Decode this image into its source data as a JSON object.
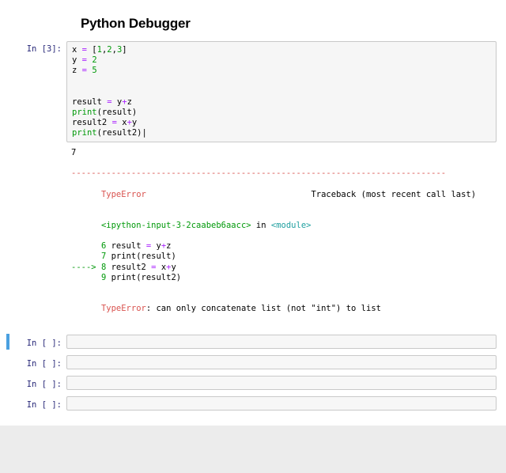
{
  "title": "Python Debugger",
  "cell": {
    "prompt": "In [3]:",
    "lines": [
      {
        "segments": [
          {
            "t": "x ",
            "c": "tok-var"
          },
          {
            "t": "=",
            "c": "tok-op"
          },
          {
            "t": " [",
            "c": "tok-var"
          },
          {
            "t": "1",
            "c": "tok-num"
          },
          {
            "t": ",",
            "c": "tok-var"
          },
          {
            "t": "2",
            "c": "tok-num"
          },
          {
            "t": ",",
            "c": "tok-var"
          },
          {
            "t": "3",
            "c": "tok-num"
          },
          {
            "t": "]",
            "c": "tok-var"
          }
        ]
      },
      {
        "segments": [
          {
            "t": "y ",
            "c": "tok-var"
          },
          {
            "t": "=",
            "c": "tok-op"
          },
          {
            "t": " ",
            "c": "tok-var"
          },
          {
            "t": "2",
            "c": "tok-num"
          }
        ]
      },
      {
        "segments": [
          {
            "t": "z ",
            "c": "tok-var"
          },
          {
            "t": "=",
            "c": "tok-op"
          },
          {
            "t": " ",
            "c": "tok-var"
          },
          {
            "t": "5",
            "c": "tok-num"
          }
        ]
      },
      {
        "segments": [
          {
            "t": " ",
            "c": "tok-var"
          }
        ]
      },
      {
        "segments": [
          {
            "t": " ",
            "c": "tok-var"
          }
        ]
      },
      {
        "segments": [
          {
            "t": "result ",
            "c": "tok-var"
          },
          {
            "t": "=",
            "c": "tok-op"
          },
          {
            "t": " y",
            "c": "tok-var"
          },
          {
            "t": "+",
            "c": "tok-op"
          },
          {
            "t": "z",
            "c": "tok-var"
          }
        ]
      },
      {
        "segments": [
          {
            "t": "print",
            "c": "tok-func"
          },
          {
            "t": "(result)",
            "c": "tok-paren"
          }
        ]
      },
      {
        "segments": [
          {
            "t": "result2 ",
            "c": "tok-var"
          },
          {
            "t": "=",
            "c": "tok-op"
          },
          {
            "t": " x",
            "c": "tok-var"
          },
          {
            "t": "+",
            "c": "tok-op"
          },
          {
            "t": "y",
            "c": "tok-var"
          }
        ]
      },
      {
        "segments": [
          {
            "t": "print",
            "c": "tok-func"
          },
          {
            "t": "(result2)",
            "c": "tok-paren"
          },
          {
            "t": "|",
            "c": "cursor"
          }
        ]
      }
    ]
  },
  "out": {
    "good": "7",
    "rule": "---------------------------------------------------------------------------",
    "trace_head_left": "TypeError",
    "trace_head_right": "Traceback (most recent call last)",
    "source": "<ipython-input-3-2caabeb6aacc>",
    "source_mid": " in ",
    "module": "<module>",
    "tb_lines": [
      {
        "arrow": "      ",
        "num": "6",
        "rest": " result ",
        "op": "=",
        "rhs": " y",
        "op2": "+",
        "rhs2": "z"
      },
      {
        "arrow": "      ",
        "num": "7",
        "rest": " ",
        "fn": "print",
        "paren": "(result)"
      },
      {
        "arrow": "----> ",
        "num": "8",
        "rest": " result2 ",
        "op": "=",
        "rhs": " x",
        "op2": "+",
        "rhs2": "y"
      },
      {
        "arrow": "      ",
        "num": "9",
        "rest": " ",
        "fn": "print",
        "paren": "(result2)"
      }
    ],
    "err_name": "TypeError",
    "err_msg": ": can only concatenate list (not \"int\") to list"
  },
  "empty_prompt": "In [ ]:"
}
